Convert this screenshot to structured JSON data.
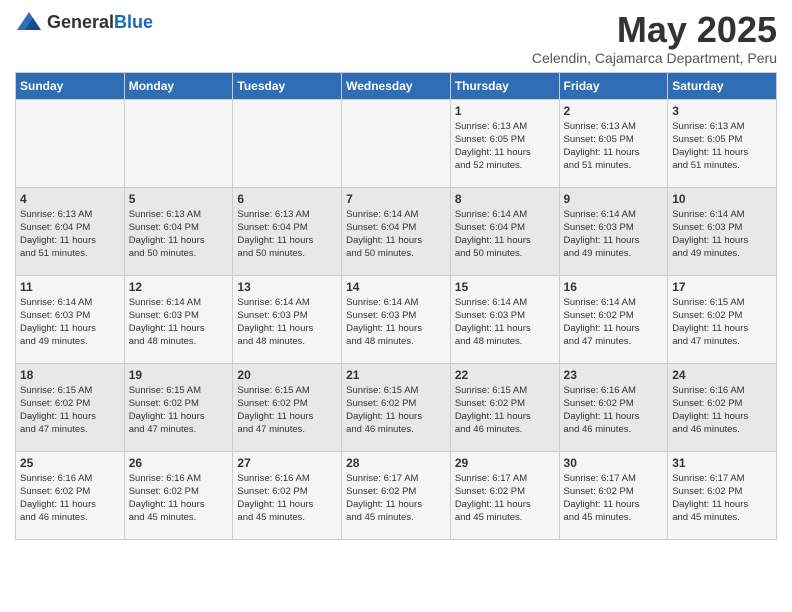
{
  "logo": {
    "general": "General",
    "blue": "Blue"
  },
  "title": "May 2025",
  "subtitle": "Celendin, Cajamarca Department, Peru",
  "weekdays": [
    "Sunday",
    "Monday",
    "Tuesday",
    "Wednesday",
    "Thursday",
    "Friday",
    "Saturday"
  ],
  "weeks": [
    [
      {
        "day": "",
        "info": ""
      },
      {
        "day": "",
        "info": ""
      },
      {
        "day": "",
        "info": ""
      },
      {
        "day": "",
        "info": ""
      },
      {
        "day": "1",
        "info": "Sunrise: 6:13 AM\nSunset: 6:05 PM\nDaylight: 11 hours\nand 52 minutes."
      },
      {
        "day": "2",
        "info": "Sunrise: 6:13 AM\nSunset: 6:05 PM\nDaylight: 11 hours\nand 51 minutes."
      },
      {
        "day": "3",
        "info": "Sunrise: 6:13 AM\nSunset: 6:05 PM\nDaylight: 11 hours\nand 51 minutes."
      }
    ],
    [
      {
        "day": "4",
        "info": "Sunrise: 6:13 AM\nSunset: 6:04 PM\nDaylight: 11 hours\nand 51 minutes."
      },
      {
        "day": "5",
        "info": "Sunrise: 6:13 AM\nSunset: 6:04 PM\nDaylight: 11 hours\nand 50 minutes."
      },
      {
        "day": "6",
        "info": "Sunrise: 6:13 AM\nSunset: 6:04 PM\nDaylight: 11 hours\nand 50 minutes."
      },
      {
        "day": "7",
        "info": "Sunrise: 6:14 AM\nSunset: 6:04 PM\nDaylight: 11 hours\nand 50 minutes."
      },
      {
        "day": "8",
        "info": "Sunrise: 6:14 AM\nSunset: 6:04 PM\nDaylight: 11 hours\nand 50 minutes."
      },
      {
        "day": "9",
        "info": "Sunrise: 6:14 AM\nSunset: 6:03 PM\nDaylight: 11 hours\nand 49 minutes."
      },
      {
        "day": "10",
        "info": "Sunrise: 6:14 AM\nSunset: 6:03 PM\nDaylight: 11 hours\nand 49 minutes."
      }
    ],
    [
      {
        "day": "11",
        "info": "Sunrise: 6:14 AM\nSunset: 6:03 PM\nDaylight: 11 hours\nand 49 minutes."
      },
      {
        "day": "12",
        "info": "Sunrise: 6:14 AM\nSunset: 6:03 PM\nDaylight: 11 hours\nand 48 minutes."
      },
      {
        "day": "13",
        "info": "Sunrise: 6:14 AM\nSunset: 6:03 PM\nDaylight: 11 hours\nand 48 minutes."
      },
      {
        "day": "14",
        "info": "Sunrise: 6:14 AM\nSunset: 6:03 PM\nDaylight: 11 hours\nand 48 minutes."
      },
      {
        "day": "15",
        "info": "Sunrise: 6:14 AM\nSunset: 6:03 PM\nDaylight: 11 hours\nand 48 minutes."
      },
      {
        "day": "16",
        "info": "Sunrise: 6:14 AM\nSunset: 6:02 PM\nDaylight: 11 hours\nand 47 minutes."
      },
      {
        "day": "17",
        "info": "Sunrise: 6:15 AM\nSunset: 6:02 PM\nDaylight: 11 hours\nand 47 minutes."
      }
    ],
    [
      {
        "day": "18",
        "info": "Sunrise: 6:15 AM\nSunset: 6:02 PM\nDaylight: 11 hours\nand 47 minutes."
      },
      {
        "day": "19",
        "info": "Sunrise: 6:15 AM\nSunset: 6:02 PM\nDaylight: 11 hours\nand 47 minutes."
      },
      {
        "day": "20",
        "info": "Sunrise: 6:15 AM\nSunset: 6:02 PM\nDaylight: 11 hours\nand 47 minutes."
      },
      {
        "day": "21",
        "info": "Sunrise: 6:15 AM\nSunset: 6:02 PM\nDaylight: 11 hours\nand 46 minutes."
      },
      {
        "day": "22",
        "info": "Sunrise: 6:15 AM\nSunset: 6:02 PM\nDaylight: 11 hours\nand 46 minutes."
      },
      {
        "day": "23",
        "info": "Sunrise: 6:16 AM\nSunset: 6:02 PM\nDaylight: 11 hours\nand 46 minutes."
      },
      {
        "day": "24",
        "info": "Sunrise: 6:16 AM\nSunset: 6:02 PM\nDaylight: 11 hours\nand 46 minutes."
      }
    ],
    [
      {
        "day": "25",
        "info": "Sunrise: 6:16 AM\nSunset: 6:02 PM\nDaylight: 11 hours\nand 46 minutes."
      },
      {
        "day": "26",
        "info": "Sunrise: 6:16 AM\nSunset: 6:02 PM\nDaylight: 11 hours\nand 45 minutes."
      },
      {
        "day": "27",
        "info": "Sunrise: 6:16 AM\nSunset: 6:02 PM\nDaylight: 11 hours\nand 45 minutes."
      },
      {
        "day": "28",
        "info": "Sunrise: 6:17 AM\nSunset: 6:02 PM\nDaylight: 11 hours\nand 45 minutes."
      },
      {
        "day": "29",
        "info": "Sunrise: 6:17 AM\nSunset: 6:02 PM\nDaylight: 11 hours\nand 45 minutes."
      },
      {
        "day": "30",
        "info": "Sunrise: 6:17 AM\nSunset: 6:02 PM\nDaylight: 11 hours\nand 45 minutes."
      },
      {
        "day": "31",
        "info": "Sunrise: 6:17 AM\nSunset: 6:02 PM\nDaylight: 11 hours\nand 45 minutes."
      }
    ]
  ]
}
